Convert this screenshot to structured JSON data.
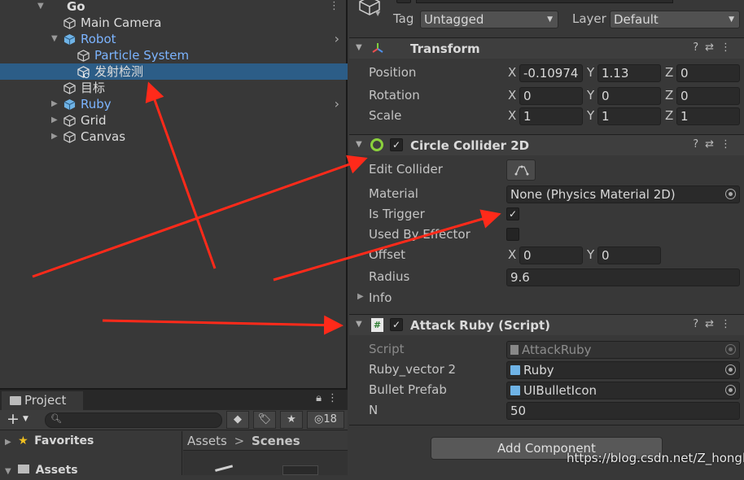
{
  "hierarchy": {
    "items": [
      {
        "label": "Go"
      },
      {
        "label": "Main Camera"
      },
      {
        "label": "Robot"
      },
      {
        "label": "Particle System"
      },
      {
        "label": "发射检测"
      },
      {
        "label": "目标"
      },
      {
        "label": "Ruby"
      },
      {
        "label": "Grid"
      },
      {
        "label": "Canvas"
      }
    ]
  },
  "project": {
    "tab_label": "Project",
    "add_label": "+",
    "count_label": "18",
    "favorites_label": "Favorites",
    "assets_label": "Assets",
    "breadcrumb": {
      "root": "Assets",
      "separator": ">",
      "current": "Scenes"
    }
  },
  "inspector": {
    "tag_label": "Tag",
    "tag_value": "Untagged",
    "layer_label": "Layer",
    "layer_value": "Default",
    "transform": {
      "title": "Transform",
      "position_label": "Position",
      "rotation_label": "Rotation",
      "scale_label": "Scale",
      "axes": {
        "x": "X",
        "y": "Y",
        "z": "Z"
      },
      "position": {
        "x": "-0.10974",
        "y": "1.13",
        "z": "0"
      },
      "rotation": {
        "x": "0",
        "y": "0",
        "z": "0"
      },
      "scale": {
        "x": "1",
        "y": "1",
        "z": "1"
      }
    },
    "collider": {
      "title": "Circle Collider 2D",
      "edit_collider_label": "Edit Collider",
      "material_label": "Material",
      "material_value": "None (Physics Material 2D)",
      "is_trigger_label": "Is Trigger",
      "used_by_effector_label": "Used By Effector",
      "offset_label": "Offset",
      "offset": {
        "x": "0",
        "y": "0"
      },
      "radius_label": "Radius",
      "radius_value": "9.6",
      "info_label": "Info"
    },
    "script": {
      "title": "Attack Ruby (Script)",
      "script_label": "Script",
      "script_value": "AttackRuby",
      "ruby_vector_label": "Ruby_vector 2",
      "ruby_vector_value": "Ruby",
      "bullet_prefab_label": "Bullet Prefab",
      "bullet_prefab_value": "UIBulletIcon",
      "n_label": "N",
      "n_value": "50"
    },
    "add_component_label": "Add Component"
  },
  "watermark": "https://blog.csdn.net/Z_hongli",
  "colors": {
    "selection": "#2c5d87",
    "arrow": "#ff2a1a",
    "link_blue": "#7cb4ff"
  }
}
